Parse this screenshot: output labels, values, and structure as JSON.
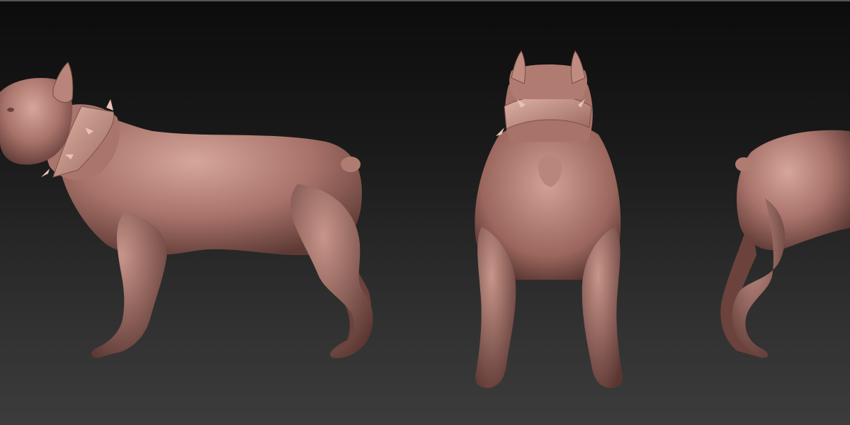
{
  "scene": {
    "material_color": "#b8837a",
    "material_shadow": "#6e4540",
    "material_highlight": "#d9aaa0",
    "collar_color": "#c99a8a",
    "views": [
      "side-view",
      "rear-view",
      "side-view-cropped"
    ]
  }
}
